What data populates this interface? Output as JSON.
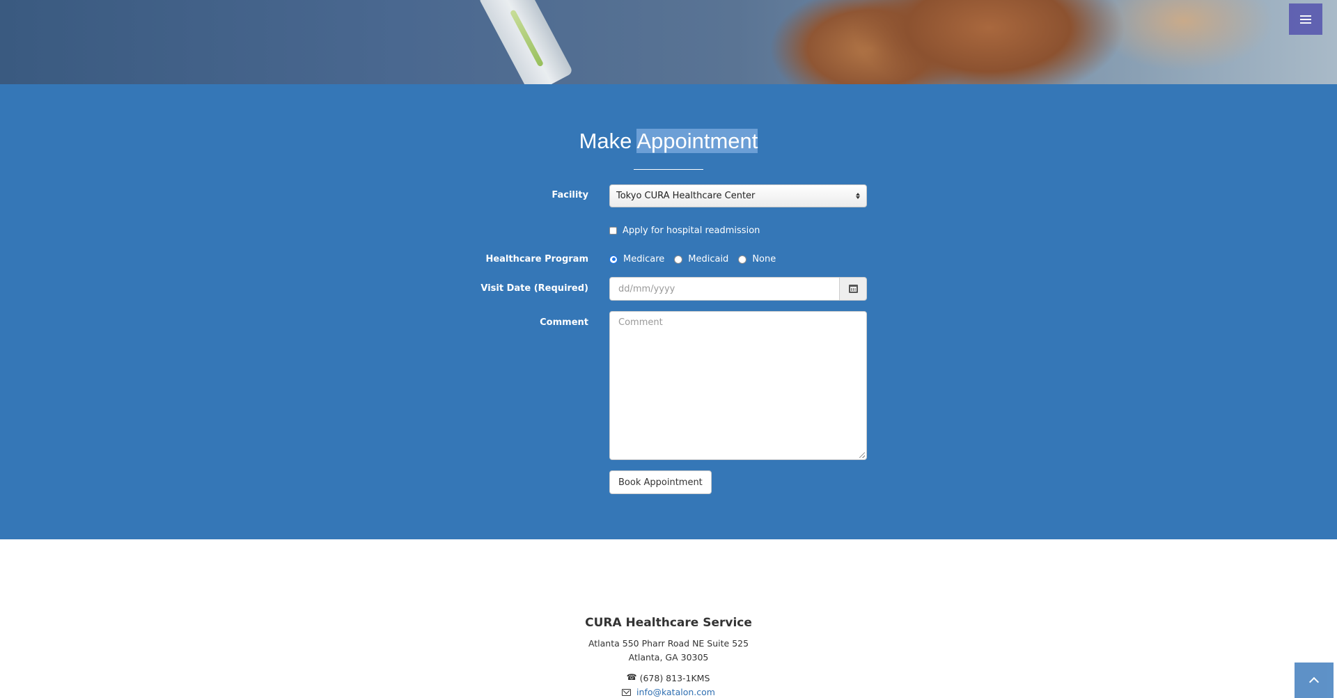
{
  "navigation": {
    "menu_toggle_icon": "hamburger-icon"
  },
  "appointment": {
    "title_prefix": "Make",
    "title_highlight": "Appointment",
    "facility": {
      "label": "Facility",
      "selected": "Tokyo CURA Healthcare Center"
    },
    "readmission": {
      "label": "Apply for hospital readmission",
      "checked": false
    },
    "program": {
      "label": "Healthcare Program",
      "options": [
        "Medicare",
        "Medicaid",
        "None"
      ],
      "selected": "Medicare"
    },
    "visit_date": {
      "label": "Visit Date (Required)",
      "placeholder": "dd/mm/yyyy",
      "icon": "calendar-icon"
    },
    "comment": {
      "label": "Comment",
      "placeholder": "Comment"
    },
    "submit_label": "Book Appointment"
  },
  "footer": {
    "company": "CURA Healthcare Service",
    "address_line1": "Atlanta 550 Pharr Road NE Suite 525",
    "address_line2": "Atlanta, GA 30305",
    "phone": "(678) 813-1KMS",
    "email": "info@katalon.com"
  },
  "colors": {
    "section_bg": "#3577b7",
    "menu_bg": "#5b5bb0",
    "link": "#2f6fb1"
  }
}
